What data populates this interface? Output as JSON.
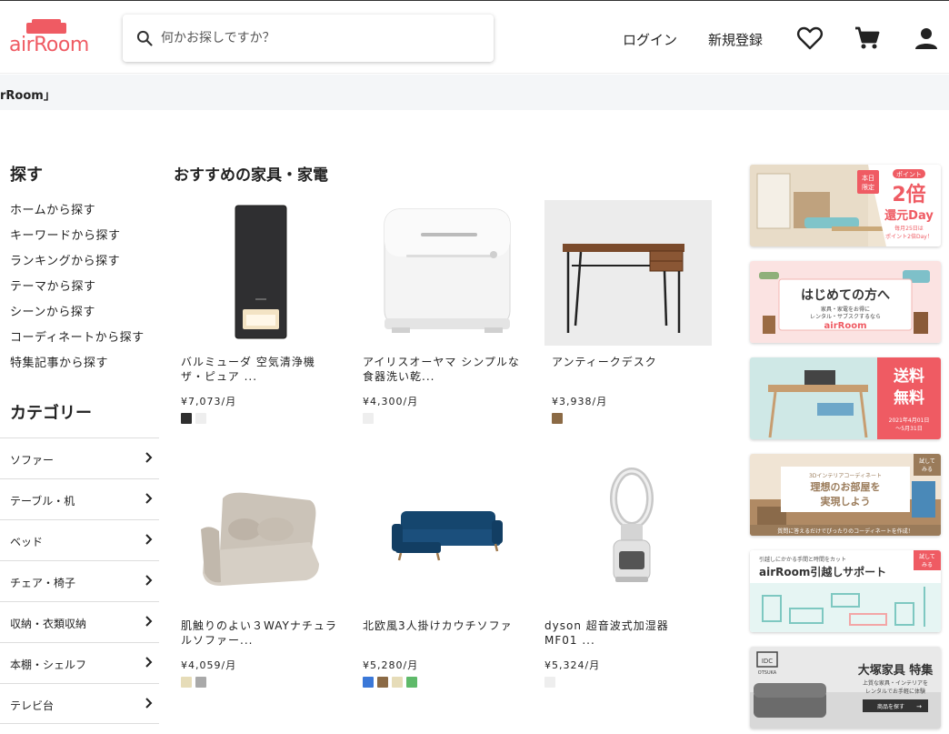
{
  "header": {
    "logo_text": "airRoom",
    "search_placeholder": "何かお探しですか？",
    "login_label": "ログイン",
    "signup_label": "新規登録",
    "icons": [
      "heart-icon",
      "cart-icon",
      "user-icon"
    ],
    "brand_color": "#ef5b63"
  },
  "breadcrumb": {
    "text": "rRoom」"
  },
  "sidebar": {
    "explore_title": "探す",
    "explore_items": [
      "ホームから探す",
      "キーワードから探す",
      "ランキングから探す",
      "テーマから探す",
      "シーンから探す",
      "コーディネートから探す",
      "特集記事から探す"
    ],
    "category_title": "カテゴリー",
    "categories": [
      "ソファー",
      "テーブル・机",
      "ベッド",
      "チェア・椅子",
      "収納・衣類収納",
      "本棚・シェルフ",
      "テレビ台"
    ]
  },
  "main": {
    "section_title": "おすすめの家具・家電",
    "products": [
      {
        "name": "バルミューダ 空気清浄機 ザ・ピュア ...",
        "price": "¥7,073/月",
        "colors": [
          "#2e2e2e",
          "#eeeeee"
        ]
      },
      {
        "name": "アイリスオーヤマ シンプルな食器洗い乾...",
        "price": "¥4,300/月",
        "colors": [
          "#eeeeee"
        ]
      },
      {
        "name": "アンティークデスク",
        "price": "¥3,938/月",
        "colors": [
          "#8b6a45"
        ]
      },
      {
        "name": "肌触りのよい３WAYナチュラルソファー...",
        "price": "¥4,059/月",
        "colors": [
          "#e6dcb8",
          "#a9a9a9"
        ]
      },
      {
        "name": "北欧風3人掛けカウチソファ",
        "price": "¥5,280/月",
        "colors": [
          "#3b78d8",
          "#8b6a45",
          "#e6dcb8",
          "#5fba6a"
        ]
      },
      {
        "name": "dyson 超音波式加湿器 MF01 ...",
        "price": "¥5,324/月",
        "colors": [
          "#eeeeee"
        ]
      }
    ]
  },
  "banners": [
    {
      "badge": "本日限定",
      "sub": "ポイント",
      "main": "2倍",
      "tail": "還元Day",
      "note": "毎月25日はポイント2倍Day！"
    },
    {
      "title": "はじめての方へ",
      "sub": "家具・家電をお得に レンタル・サブスクするなら",
      "brand": "airRoom"
    },
    {
      "main": "送料無料",
      "note": "2021年4月01日〜5月31日"
    },
    {
      "badge": "試してみる",
      "small": "3Dインテリアコーディネート",
      "title": "理想のお部屋を実現しよう",
      "note": "質問に答えるだけでぴったりのコーディネートを作成！"
    },
    {
      "badge": "試してみる",
      "small": "引越しにかかる手間と時間をカット",
      "title": "airRoom引越しサポート"
    },
    {
      "logo": "IDC OTSUKA",
      "title": "大塚家具 特集",
      "sub": "上質な家具・インテリアを レンタルでお手軽に体験",
      "cta": "商品を探す"
    }
  ]
}
